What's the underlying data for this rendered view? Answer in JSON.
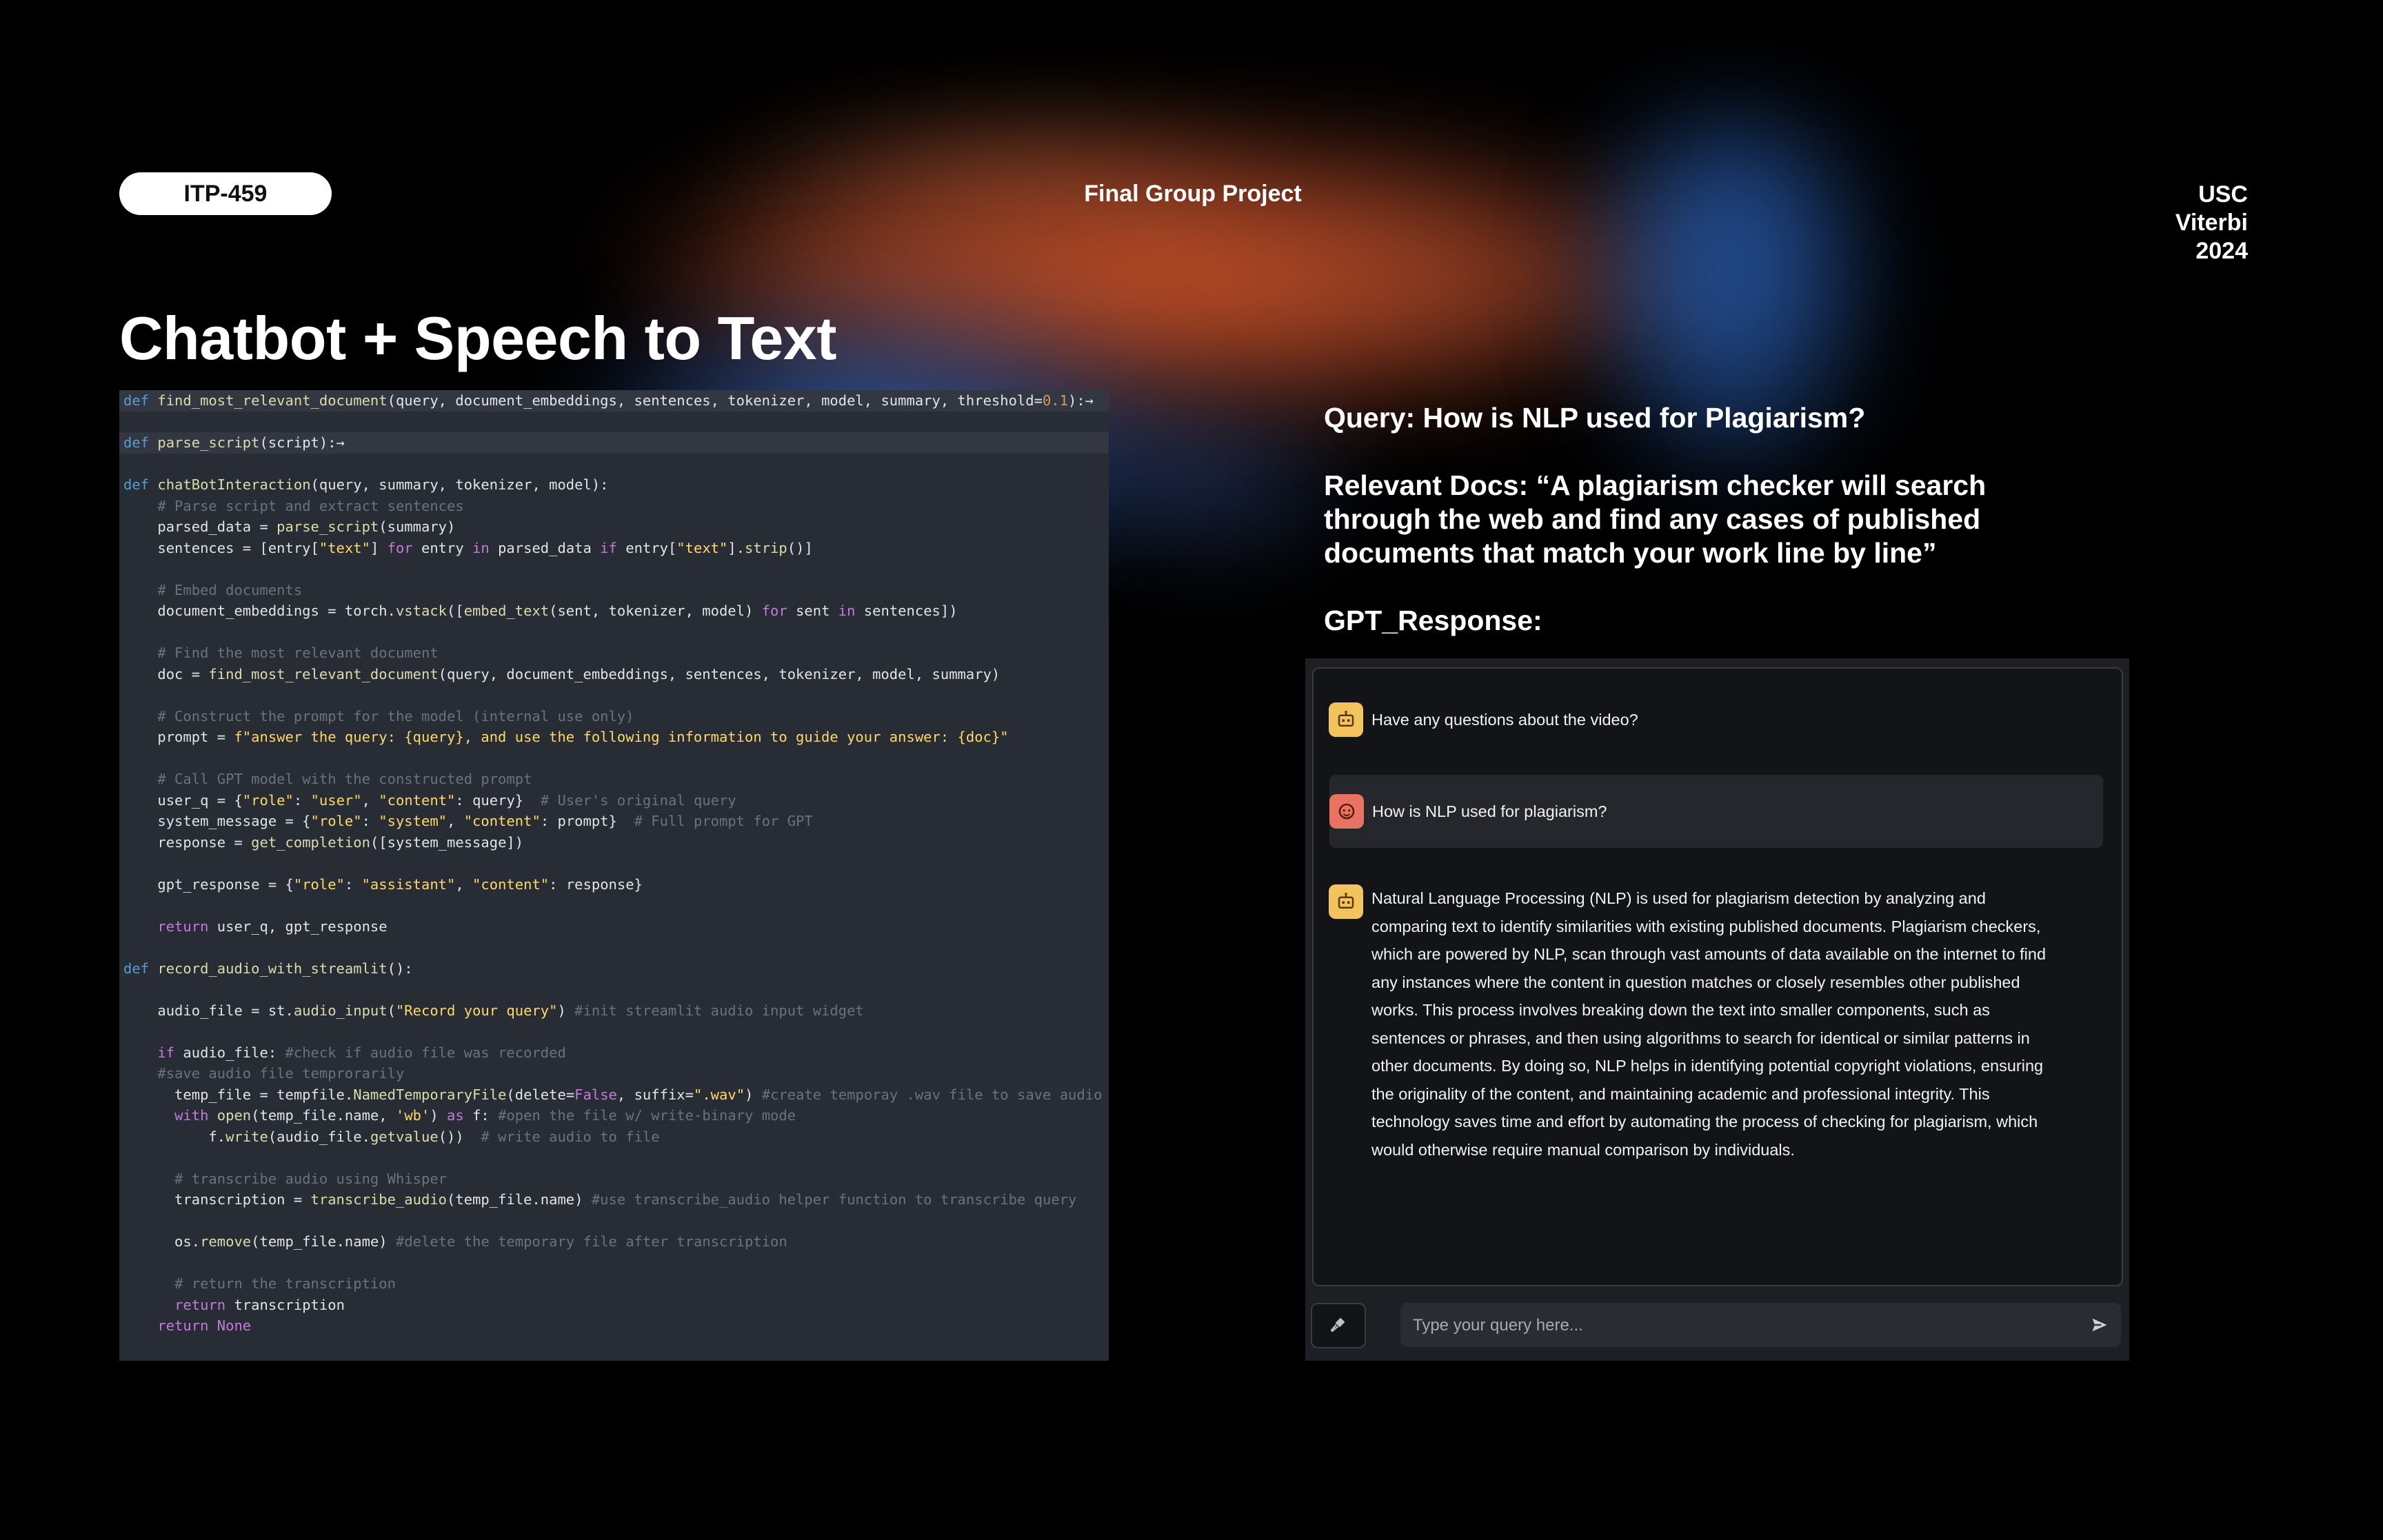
{
  "header": {
    "course_badge": "ITP-459",
    "project_label": "Final Group Project",
    "org_line1": "USC",
    "org_line2": "Viterbi",
    "org_line3": "2024"
  },
  "slide_title": "Chatbot + Speech to Text",
  "code_editor": {
    "colors": {
      "background": "#282c34",
      "keyword": "#569cd6",
      "function": "#dcdcaa",
      "param": "#d6b85a",
      "string": "#ffd866",
      "comment": "#6a737d"
    },
    "lines": [
      {
        "text": "def find_most_relevant_document(query, document_embeddings, sentences, tokenizer, model, summary, threshold=0.1):→",
        "folded": true
      },
      {
        "text": "",
        "folded": false
      },
      {
        "text": "def parse_script(script):→",
        "folded": true
      },
      {
        "text": "",
        "folded": false
      },
      {
        "text": "def chatBotInteraction(query, summary, tokenizer, model):",
        "folded": false
      },
      {
        "text": "    # Parse script and extract sentences",
        "folded": false
      },
      {
        "text": "    parsed_data = parse_script(summary)",
        "folded": false
      },
      {
        "text": "    sentences = [entry[\"text\"] for entry in parsed_data if entry[\"text\"].strip()]",
        "folded": false
      },
      {
        "text": "",
        "folded": false
      },
      {
        "text": "    # Embed documents",
        "folded": false
      },
      {
        "text": "    document_embeddings = torch.vstack([embed_text(sent, tokenizer, model) for sent in sentences])",
        "folded": false
      },
      {
        "text": "",
        "folded": false
      },
      {
        "text": "    # Find the most relevant document",
        "folded": false
      },
      {
        "text": "    doc = find_most_relevant_document(query, document_embeddings, sentences, tokenizer, model, summary)",
        "folded": false
      },
      {
        "text": "",
        "folded": false
      },
      {
        "text": "    # Construct the prompt for the model (internal use only)",
        "folded": false
      },
      {
        "text": "    prompt = f\"answer the query: {query}, and use the following information to guide your answer: {doc}\"",
        "folded": false
      },
      {
        "text": "",
        "folded": false
      },
      {
        "text": "    # Call GPT model with the constructed prompt",
        "folded": false
      },
      {
        "text": "    user_q = {\"role\": \"user\", \"content\": query}  # User's original query",
        "folded": false
      },
      {
        "text": "    system_message = {\"role\": \"system\", \"content\": prompt}  # Full prompt for GPT",
        "folded": false
      },
      {
        "text": "    response = get_completion([system_message])",
        "folded": false
      },
      {
        "text": "",
        "folded": false
      },
      {
        "text": "    gpt_response = {\"role\": \"assistant\", \"content\": response}",
        "folded": false
      },
      {
        "text": "",
        "folded": false
      },
      {
        "text": "    return user_q, gpt_response",
        "folded": false
      },
      {
        "text": "",
        "folded": false
      },
      {
        "text": "def record_audio_with_streamlit():",
        "folded": false
      },
      {
        "text": "",
        "folded": false
      },
      {
        "text": "    audio_file = st.audio_input(\"Record your query\") #init streamlit audio input widget",
        "folded": false
      },
      {
        "text": "",
        "folded": false
      },
      {
        "text": "    if audio_file: #check if audio file was recorded",
        "folded": false
      },
      {
        "text": "    #save audio file temprorarily",
        "folded": false
      },
      {
        "text": "      temp_file = tempfile.NamedTemporaryFile(delete=False, suffix=\".wav\") #create temporay .wav file to save audio",
        "folded": false
      },
      {
        "text": "      with open(temp_file.name, 'wb') as f: #open the file w/ write-binary mode",
        "folded": false
      },
      {
        "text": "          f.write(audio_file.getvalue())  # write audio to file",
        "folded": false
      },
      {
        "text": "",
        "folded": false
      },
      {
        "text": "      # transcribe audio using Whisper",
        "folded": false
      },
      {
        "text": "      transcription = transcribe_audio(temp_file.name) #use transcribe_audio helper function to transcribe query",
        "folded": false
      },
      {
        "text": "",
        "folded": false
      },
      {
        "text": "      os.remove(temp_file.name) #delete the temporary file after transcription",
        "folded": false
      },
      {
        "text": "",
        "folded": false
      },
      {
        "text": "      # return the transcription",
        "folded": false
      },
      {
        "text": "      return transcription",
        "folded": false
      },
      {
        "text": "    return None",
        "folded": false
      }
    ]
  },
  "query_panel": {
    "query_line": "Query: How is NLP used for Plagiarism?",
    "relevant_docs": "Relevant Docs: “A plagiarism checker will search through the web and find any cases of published documents that match your work line by line”",
    "gpt_response_label": "GPT_Response:"
  },
  "chat": {
    "colors": {
      "panel": "#1e1f24",
      "bot_avatar": "#f3c45d",
      "user_avatar": "#e97363"
    },
    "messages": [
      {
        "role": "assistant",
        "avatar_icon": "robot-icon",
        "text": "Have any questions about the video?"
      },
      {
        "role": "user",
        "avatar_icon": "face-icon",
        "text": "How is NLP used for plagiarism?"
      },
      {
        "role": "assistant",
        "avatar_icon": "robot-icon",
        "lines": [
          "Natural Language Processing (NLP) is used for plagiarism detection by analyzing and",
          "comparing text to identify similarities with existing published documents. Plagiarism checkers,",
          "which are powered by NLP, scan through vast amounts of data available on the internet to find",
          "any instances where the content in question matches or closely resembles other published",
          "works. This process involves breaking down the text into smaller components, such as",
          "sentences or phrases, and then using algorithms to search for identical or similar patterns in",
          "other documents. By doing so, NLP helps in identifying potential copyright violations, ensuring",
          "the originality of the content, and maintaining academic and professional integrity. This",
          "technology saves time and effort by automating the process of checking for plagiarism, which",
          "would otherwise require manual comparison by individuals."
        ]
      }
    ],
    "input_placeholder": "Type your query here...",
    "mic_icon": "microphone-icon",
    "send_icon": "send-icon"
  }
}
